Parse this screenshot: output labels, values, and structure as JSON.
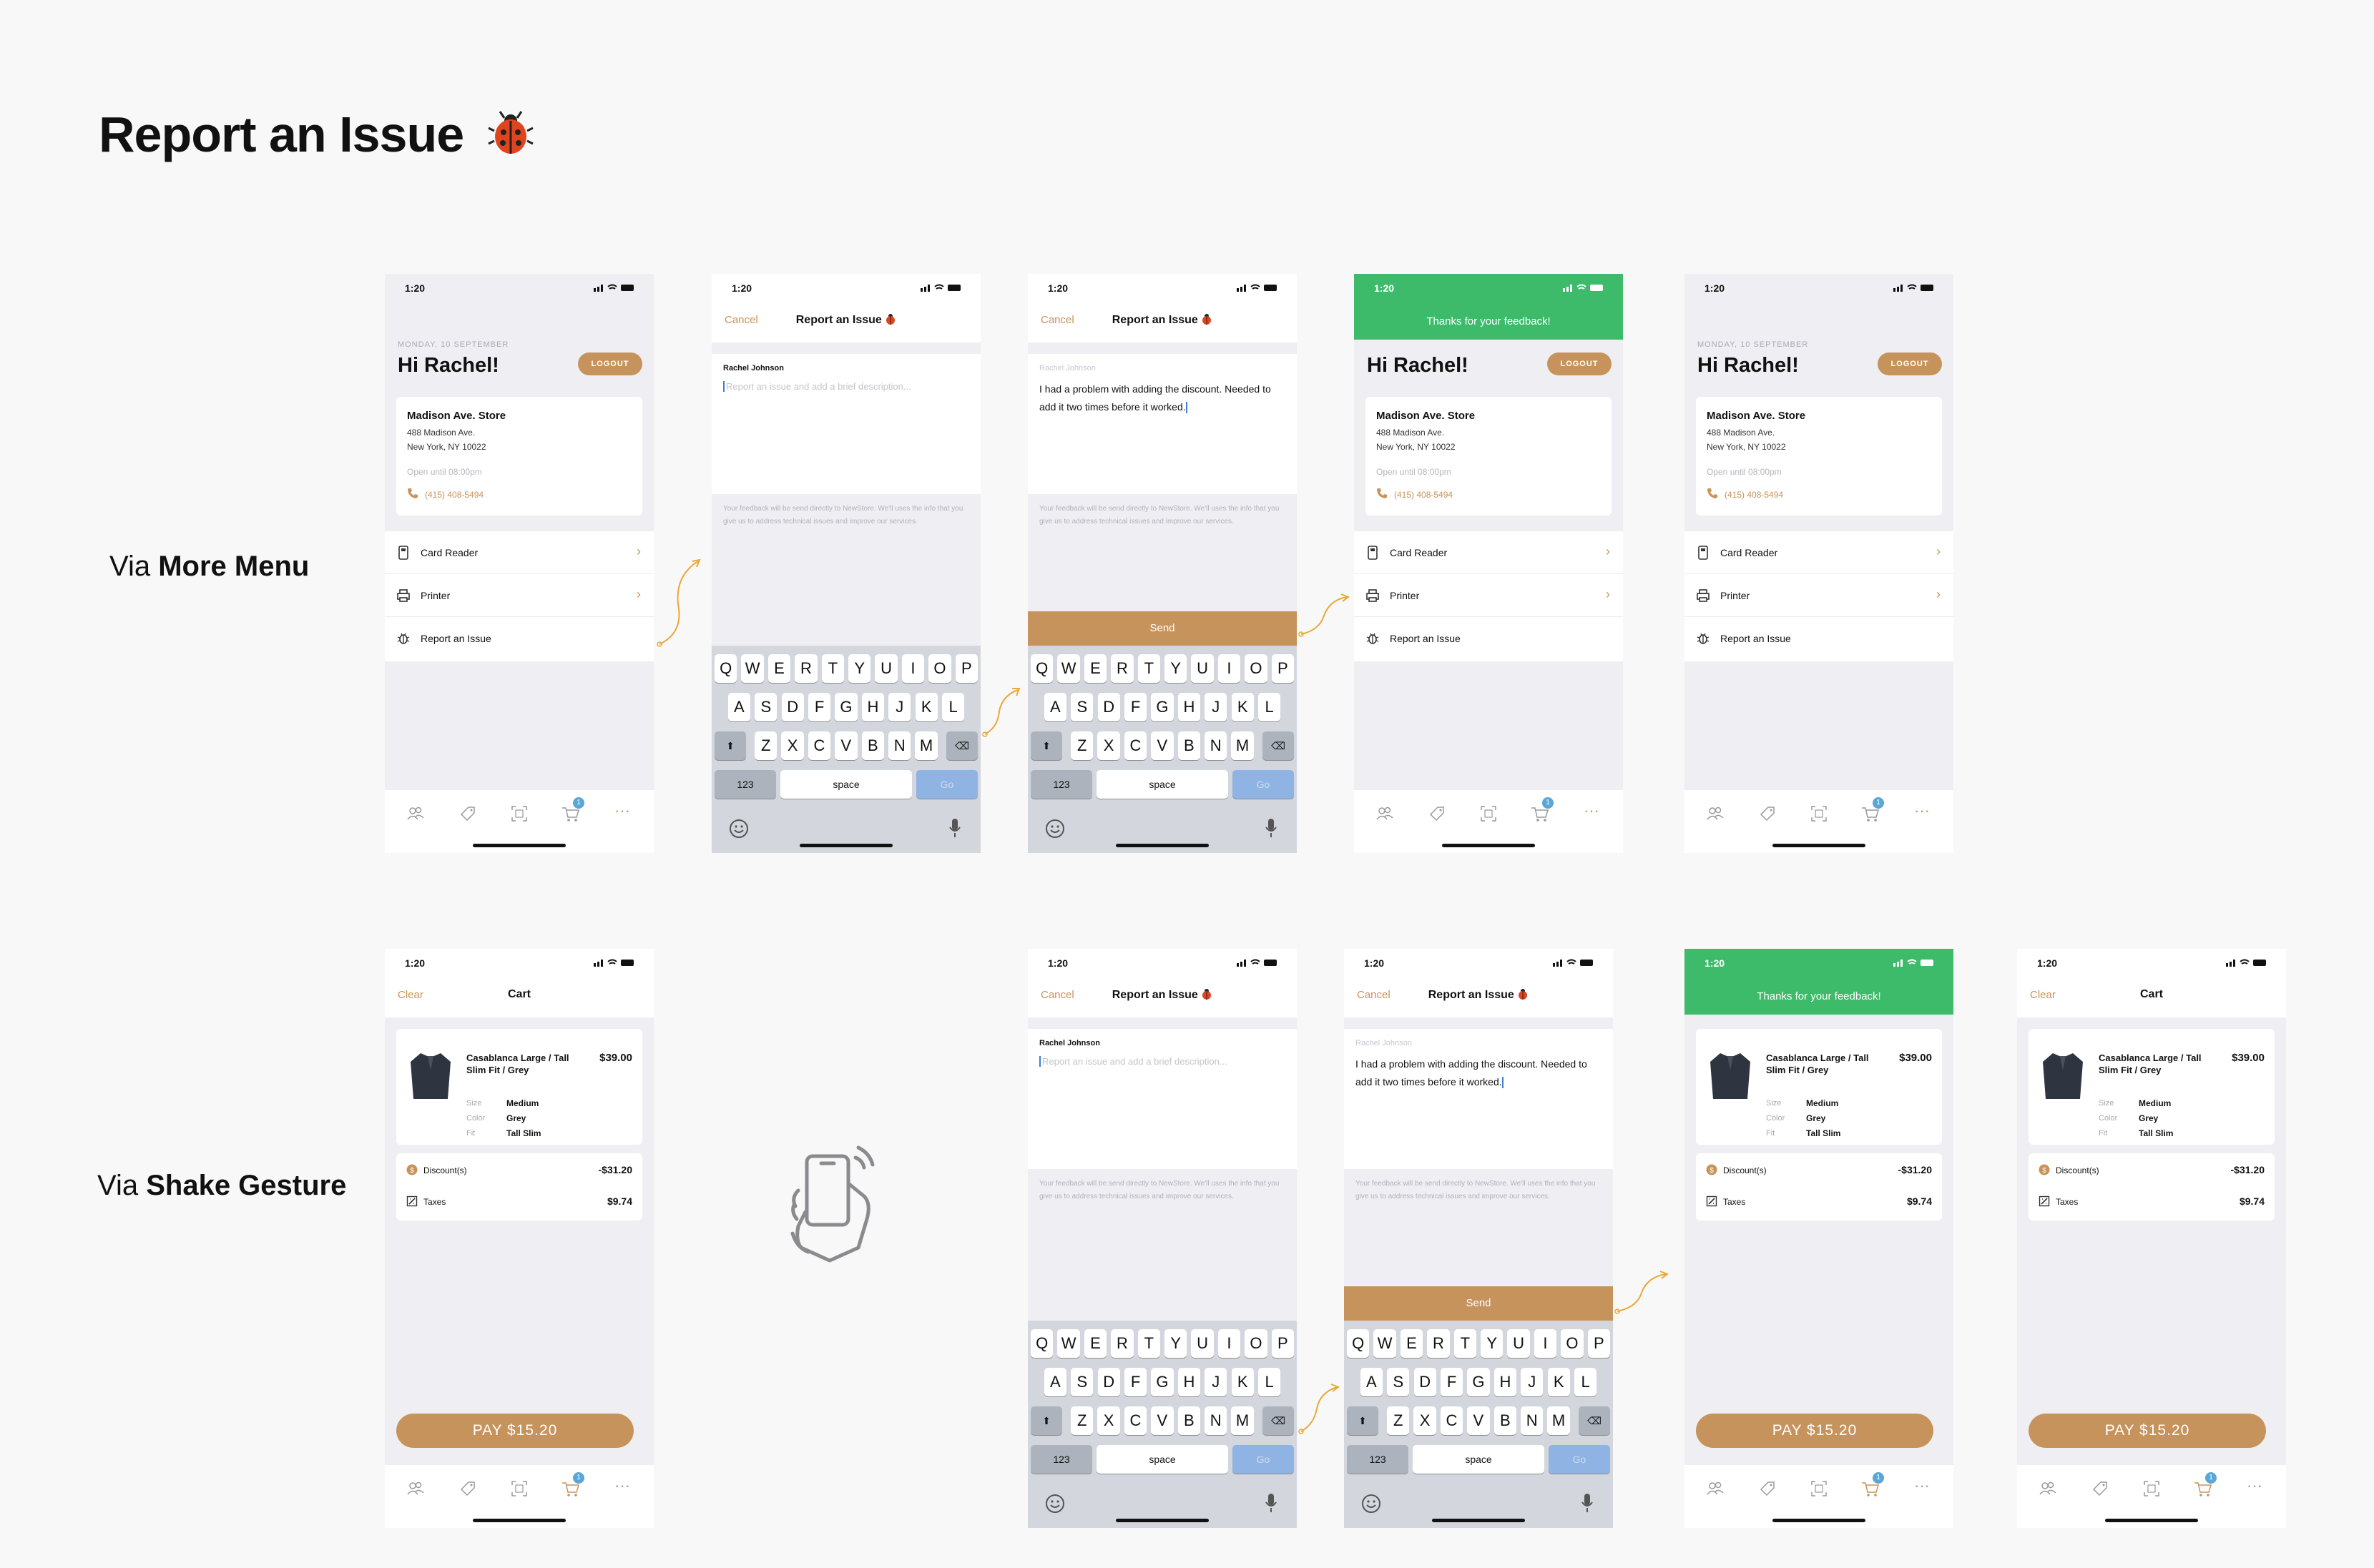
{
  "page": {
    "title": "Report an Issue"
  },
  "rows": {
    "more_menu": {
      "prefix": "Via",
      "emph": "More Menu"
    },
    "shake": {
      "prefix": "Via",
      "emph": "Shake Gesture"
    }
  },
  "status": {
    "time": "1:20"
  },
  "home": {
    "date": "MONDAY, 10 SEPTEMBER",
    "greeting": "Hi Rachel!",
    "logout": "LOGOUT",
    "store_name": "Madison Ave. Store",
    "address1": "488 Madison Ave.",
    "address2": "New York, NY 10022",
    "open": "Open until 08:00pm",
    "phone": "(415) 408-5494",
    "menu": [
      "Card Reader",
      "Printer",
      "Report an Issue"
    ]
  },
  "tabs": {
    "cart_badge": "1",
    "more": "···"
  },
  "report": {
    "cancel": "Cancel",
    "title": "Report an Issue",
    "author": "Rachel Johnson",
    "placeholder": "Report an issue and add a brief description...",
    "message": "I had a problem with adding the discount. Needed to add it two times before it worked.",
    "note": "Your feedback will be send directly to NewStore. We'll uses the info that you give us to address technical issues and improve our services.",
    "send": "Send"
  },
  "success": {
    "message": "Thanks for your feedback!"
  },
  "keyboard": {
    "row1": [
      "Q",
      "W",
      "E",
      "R",
      "T",
      "Y",
      "U",
      "I",
      "O",
      "P"
    ],
    "row2": [
      "A",
      "S",
      "D",
      "F",
      "G",
      "H",
      "J",
      "K",
      "L"
    ],
    "row3": [
      "Z",
      "X",
      "C",
      "V",
      "B",
      "N",
      "M"
    ],
    "numbers": "123",
    "space": "space",
    "go": "Go"
  },
  "cart": {
    "clear": "Clear",
    "title": "Cart",
    "item_name": "Casablanca Large / Tall Slim Fit / Grey",
    "item_price": "$39.00",
    "size_label": "Size",
    "size": "Medium",
    "color_label": "Color",
    "color": "Grey",
    "fit_label": "Fit",
    "fit": "Tall Slim",
    "discount_label": "Discount(s)",
    "discount": "-$31.20",
    "taxes_label": "Taxes",
    "taxes": "$9.74",
    "pay": "PAY $15.20"
  },
  "colors": {
    "accent": "#c6935c",
    "success": "#3dbb6b",
    "badge": "#5aa6d6",
    "background": "#efeff3"
  }
}
